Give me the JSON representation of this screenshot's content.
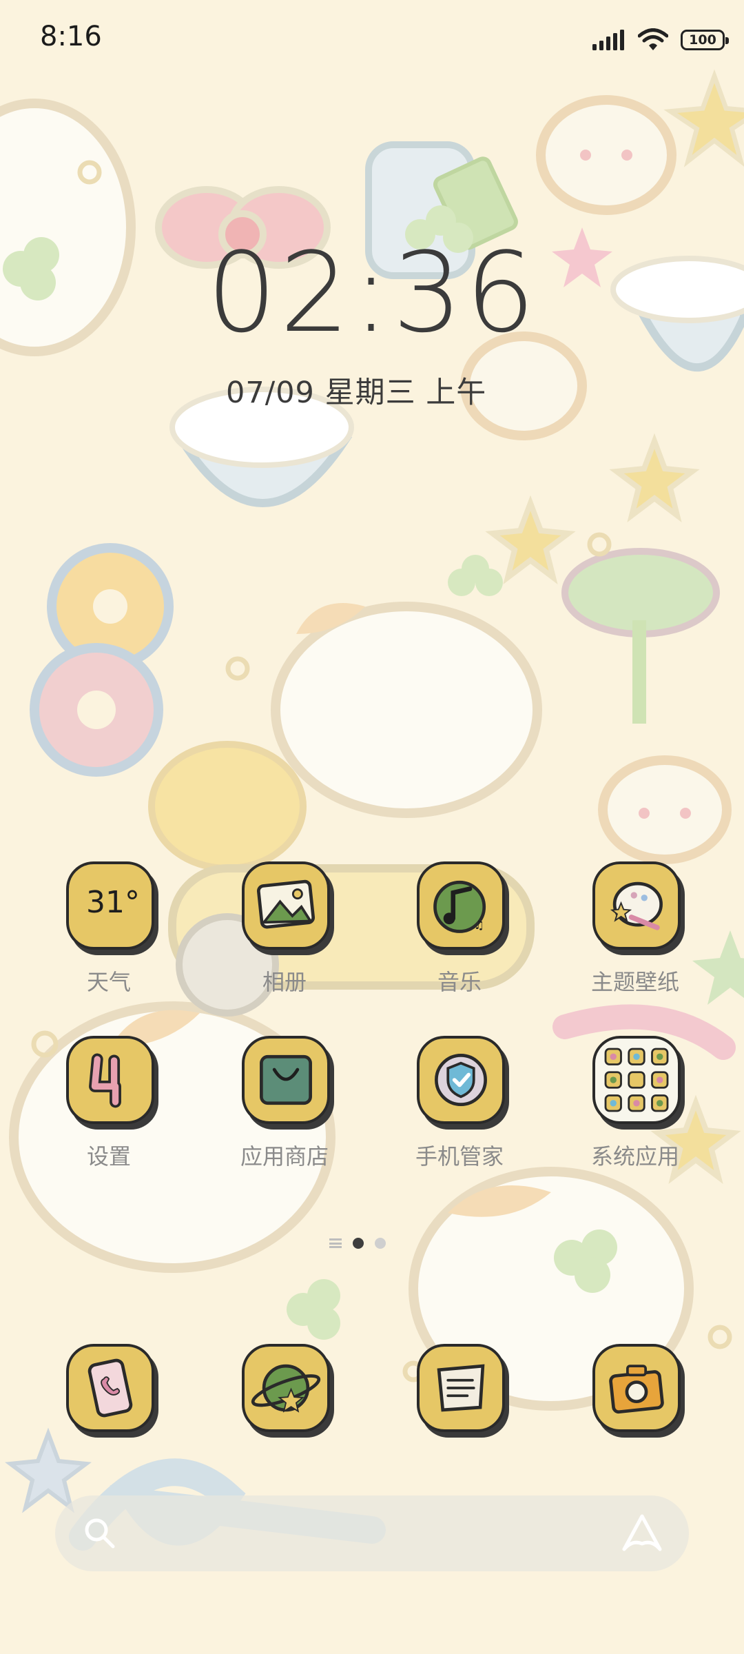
{
  "status_bar": {
    "time": "8:16",
    "battery": "100"
  },
  "clock": {
    "time": "02:36",
    "date": "07/09 星期三 上午"
  },
  "apps_row1": [
    {
      "label": "天气",
      "icon": "weather-icon",
      "temp": "31°"
    },
    {
      "label": "相册",
      "icon": "gallery-icon"
    },
    {
      "label": "音乐",
      "icon": "music-icon"
    },
    {
      "label": "主题壁纸",
      "icon": "themes-icon"
    }
  ],
  "apps_row2": [
    {
      "label": "设置",
      "icon": "settings-icon"
    },
    {
      "label": "应用商店",
      "icon": "app-store-icon"
    },
    {
      "label": "手机管家",
      "icon": "security-icon"
    },
    {
      "label": "系统应用",
      "icon": "folder-icon"
    }
  ],
  "dock": [
    {
      "icon": "phone-icon"
    },
    {
      "icon": "browser-icon"
    },
    {
      "icon": "notes-icon"
    },
    {
      "icon": "camera-icon"
    }
  ],
  "page_indicator": {
    "pages": 2,
    "active": 0
  },
  "search": {
    "left_icon": "search-icon",
    "right_icon": "assistant-icon"
  },
  "colors": {
    "background": "#fbf3de",
    "icon_tile": "#e6c766",
    "label": "#8a8a8a",
    "clock": "#3b3b3b"
  }
}
